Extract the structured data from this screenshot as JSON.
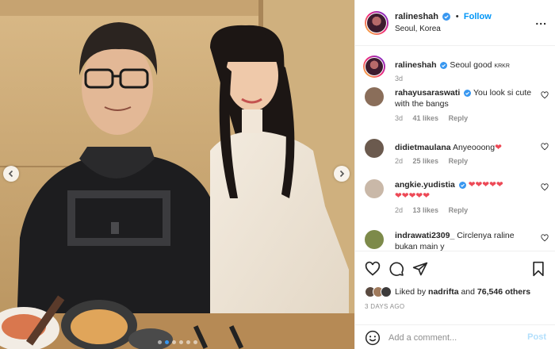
{
  "post": {
    "username": "ralineshah",
    "follow_label": "Follow",
    "separator": "•",
    "location": "Seoul, Korea",
    "more_label": "...",
    "caption_text": "Seoul good",
    "caption_small": "KRKR",
    "caption_time": "3d"
  },
  "comments": [
    {
      "username": "rahayusaraswati",
      "verified": true,
      "text": "You look si cute with the bangs",
      "time": "3d",
      "likes": "41 likes",
      "reply": "Reply",
      "avatar_color": "#8a6e5a"
    },
    {
      "username": "didietmaulana",
      "verified": false,
      "text": "Anyeooong",
      "emoji": "❤",
      "time": "2d",
      "likes": "25 likes",
      "reply": "Reply",
      "avatar_color": "#6b5a4e"
    },
    {
      "username": "angkie.yudistia",
      "verified": true,
      "text": "❤❤❤❤❤",
      "text2": "❤❤❤❤❤",
      "time": "2d",
      "likes": "13 likes",
      "reply": "Reply",
      "avatar_color": "#c9b8a8"
    },
    {
      "username": "indrawati2309_",
      "verified": false,
      "text": "Circlenya raline bukan main y",
      "avatar_color": "#7d8a4a"
    }
  ],
  "likes": {
    "prefix": "Liked by",
    "user": "nadrifta",
    "connector": "and",
    "others": "76,546 others"
  },
  "date_label": "3 DAYS AGO",
  "add_comment": {
    "placeholder": "Add a comment...",
    "post_label": "Post"
  },
  "colors": {
    "accent": "#0095f6",
    "heart": "#ed4956",
    "muted": "#8e8e8e"
  },
  "carousel": {
    "count": 6,
    "active": 1
  }
}
